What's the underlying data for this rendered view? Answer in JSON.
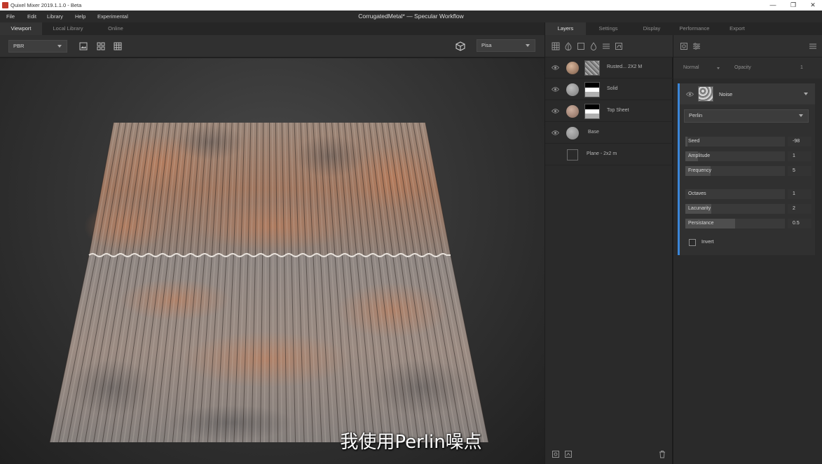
{
  "window": {
    "app_title": "Quixel Mixer 2019.1.1.0 - Beta",
    "document_title": "CorrugatedMetal* — Specular Workflow",
    "minimize": "—",
    "restore": "❐",
    "close": "✕"
  },
  "menu": {
    "items": [
      "File",
      "Edit",
      "Library",
      "Help",
      "Experimental"
    ]
  },
  "viewport_tabs": [
    "Viewport",
    "Local Library",
    "Online"
  ],
  "viewport_toolbar": {
    "render_mode": "PBR",
    "environment": "Pisa"
  },
  "right_tabs": [
    "Layers",
    "Settings",
    "Display",
    "Performance",
    "Export"
  ],
  "layers": [
    {
      "name": "Rusted... 2X2 M",
      "circle_color": "#a88a74",
      "thumb": "noise"
    },
    {
      "name": "Solid",
      "circle_color": "#9b9b9b",
      "thumb": "gradient"
    },
    {
      "name": "Top Sheet",
      "circle_color": "#a78a7a",
      "thumb": "gradient"
    },
    {
      "name": "Base",
      "circle_color": "#9b9b9b",
      "thumb": "none"
    },
    {
      "name": "Plane - 2x2 m",
      "circle_color": "",
      "thumb": "empty"
    }
  ],
  "properties": {
    "blend_mode": "Normal",
    "opacity_label": "Opacity",
    "opacity_value": "1",
    "noise_name": "Noise",
    "noise_type": "Perlin",
    "params": [
      {
        "label": "Seed",
        "value": "-98",
        "level": 0.02
      },
      {
        "label": "Amplitude",
        "value": "1",
        "level": 0.13
      },
      {
        "label": "Frequency",
        "value": "5",
        "level": 0.25
      },
      {
        "label": "Octaves",
        "value": "1",
        "level": 0.0
      },
      {
        "label": "Lacunarity",
        "value": "2",
        "level": 0.26
      },
      {
        "label": "Persistance",
        "value": "0.5",
        "level": 0.5
      }
    ],
    "invert_label": "Invert",
    "invert_checked": false
  },
  "subtitle": "我使用Perlin噪点",
  "colors": {
    "accent": "#3b86d8",
    "rust": "#b8785a",
    "metal": "#8a8580"
  }
}
